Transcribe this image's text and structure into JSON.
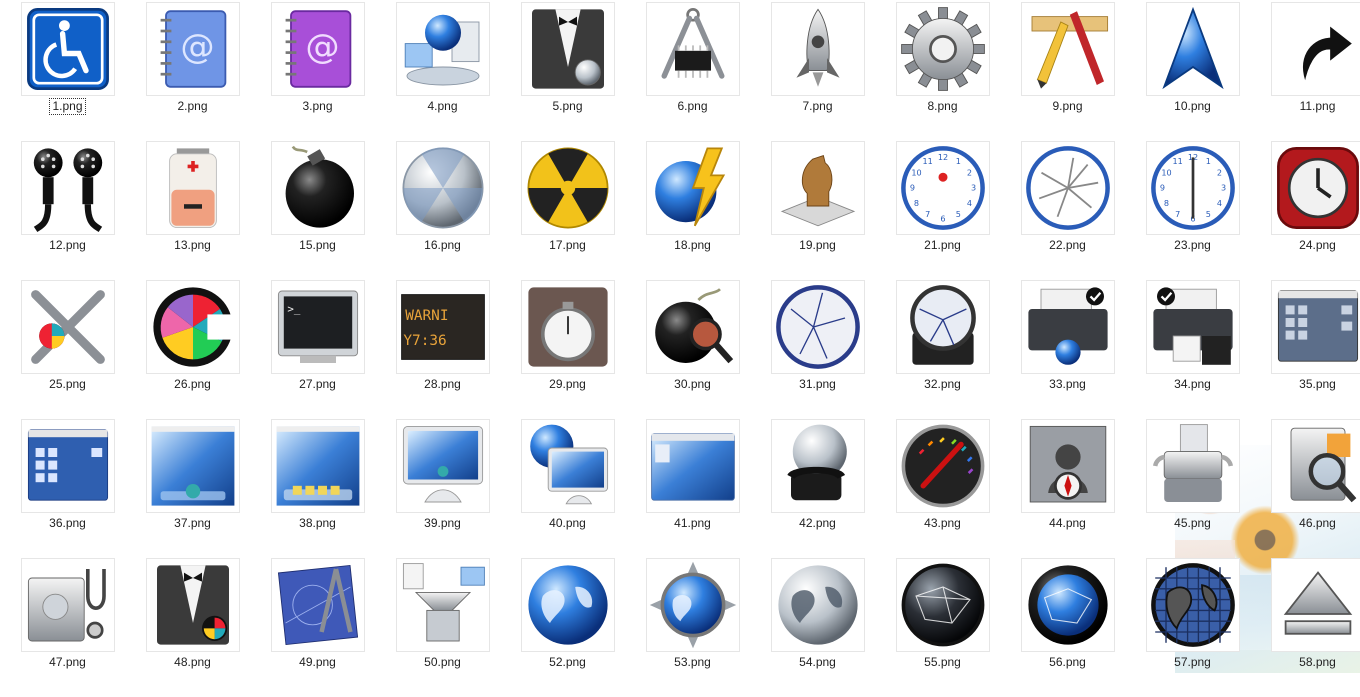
{
  "selected_index": 0,
  "icons": [
    {
      "label": "1.png",
      "icon": "accessibility-icon"
    },
    {
      "label": "2.png",
      "icon": "address-book-blue-icon"
    },
    {
      "label": "3.png",
      "icon": "address-book-purple-icon"
    },
    {
      "label": "4.png",
      "icon": "network-globe-icon"
    },
    {
      "label": "5.png",
      "icon": "tuxedo-butler-icon"
    },
    {
      "label": "6.png",
      "icon": "caliper-chip-icon"
    },
    {
      "label": "7.png",
      "icon": "rocket-icon"
    },
    {
      "label": "8.png",
      "icon": "gear-icon"
    },
    {
      "label": "9.png",
      "icon": "app-store-pencil-ruler-icon"
    },
    {
      "label": "10.png",
      "icon": "blue-arrowhead-icon"
    },
    {
      "label": "11.png",
      "icon": "alias-arrow-icon"
    },
    {
      "label": "12.png",
      "icon": "midi-cable-icon"
    },
    {
      "label": "13.png",
      "icon": "battery-low-icon"
    },
    {
      "label": "15.png",
      "icon": "bomb-icon"
    },
    {
      "label": "16.png",
      "icon": "burn-disc-white-icon"
    },
    {
      "label": "17.png",
      "icon": "burn-disc-yellow-icon"
    },
    {
      "label": "18.png",
      "icon": "globe-lightning-icon"
    },
    {
      "label": "19.png",
      "icon": "chess-knight-icon"
    },
    {
      "label": "21.png",
      "icon": "clock-apple-icon"
    },
    {
      "label": "22.png",
      "icon": "clock-multi-hands-icon"
    },
    {
      "label": "23.png",
      "icon": "clock-six-icon"
    },
    {
      "label": "24.png",
      "icon": "clock-red-square-icon"
    },
    {
      "label": "25.png",
      "icon": "color-tools-icon"
    },
    {
      "label": "26.png",
      "icon": "colorsync-icon"
    },
    {
      "label": "27.png",
      "icon": "terminal-icon"
    },
    {
      "label": "28.png",
      "icon": "console-warning-icon"
    },
    {
      "label": "29.png",
      "icon": "stopwatch-icon"
    },
    {
      "label": "30.png",
      "icon": "bomb-magnifier-icon"
    },
    {
      "label": "31.png",
      "icon": "clock-cracked-icon"
    },
    {
      "label": "32.png",
      "icon": "clock-stand-icon"
    },
    {
      "label": "33.png",
      "icon": "printer-globe-icon"
    },
    {
      "label": "34.png",
      "icon": "printer-floppy-icon"
    },
    {
      "label": "35.png",
      "icon": "desktop-gray-icon"
    },
    {
      "label": "36.png",
      "icon": "desktop-blue-icon"
    },
    {
      "label": "37.png",
      "icon": "desktop-dock-icon"
    },
    {
      "label": "38.png",
      "icon": "desktop-dock-folders-icon"
    },
    {
      "label": "39.png",
      "icon": "display-monitor-icon"
    },
    {
      "label": "40.png",
      "icon": "display-globe-icon"
    },
    {
      "label": "41.png",
      "icon": "finder-window-icon"
    },
    {
      "label": "42.png",
      "icon": "globe-telephone-icon"
    },
    {
      "label": "43.png",
      "icon": "color-meter-icon"
    },
    {
      "label": "44.png",
      "icon": "map-compass-icon"
    },
    {
      "label": "45.png",
      "icon": "disk-scanner-icon"
    },
    {
      "label": "46.png",
      "icon": "disk-magnifier-icon"
    },
    {
      "label": "47.png",
      "icon": "disk-stethoscope-icon"
    },
    {
      "label": "48.png",
      "icon": "tuxedo-color-icon"
    },
    {
      "label": "49.png",
      "icon": "blueprint-compass-icon"
    },
    {
      "label": "50.png",
      "icon": "file-funnel-icon"
    },
    {
      "label": "52.png",
      "icon": "globe-blue-icon"
    },
    {
      "label": "53.png",
      "icon": "globe-compass-icon"
    },
    {
      "label": "54.png",
      "icon": "globe-silver-icon"
    },
    {
      "label": "55.png",
      "icon": "globe-dark-network-icon"
    },
    {
      "label": "56.png",
      "icon": "globe-network-blue-icon"
    },
    {
      "label": "57.png",
      "icon": "globe-grid-icon"
    },
    {
      "label": "58.png",
      "icon": "eject-icon"
    }
  ]
}
